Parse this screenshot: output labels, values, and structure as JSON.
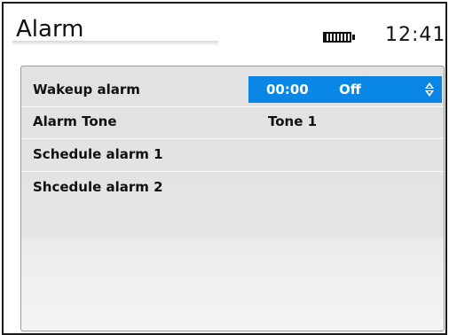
{
  "header": {
    "title": "Alarm",
    "clock": "12:41",
    "battery_icon": "battery-full-icon"
  },
  "alarm_list": {
    "items": [
      {
        "label": "Wakeup alarm",
        "time": "00:00",
        "state": "Off",
        "selected": true
      },
      {
        "label": "Alarm Tone",
        "value": "Tone 1"
      },
      {
        "label": "Schedule alarm 1"
      },
      {
        "label": "Shcedule alarm 2"
      }
    ]
  },
  "colors": {
    "selection": "#0a86e6",
    "panel": "#e2e2e2",
    "text": "#111111"
  }
}
